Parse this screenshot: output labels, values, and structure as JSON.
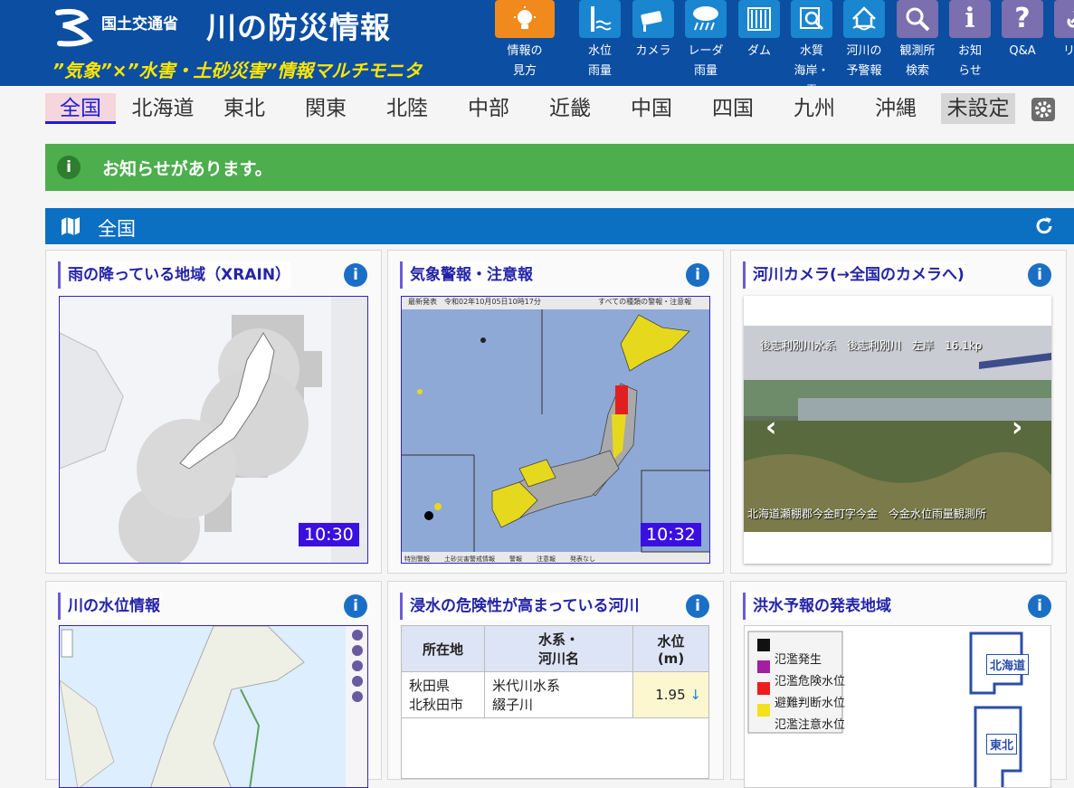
{
  "header": {
    "ministry": "国土交通省",
    "title": "川の防災情報",
    "subtitle": "”気象”×”水害・土砂災害”情報マルチモニタ",
    "icons": [
      {
        "label1": "情報の",
        "label2": "見方",
        "icon": "lightbulb-icon",
        "color": "#f08a1c"
      },
      {
        "label1": "水位",
        "label2": "雨量",
        "icon": "water-level-icon",
        "color": "#1a86d0"
      },
      {
        "label1": "カメラ",
        "label2": "",
        "icon": "camera-icon",
        "color": "#1a86d0"
      },
      {
        "label1": "レーダ",
        "label2": "雨量",
        "icon": "radar-icon",
        "color": "#1a86d0"
      },
      {
        "label1": "ダム",
        "label2": "",
        "icon": "dam-icon",
        "color": "#1a86d0"
      },
      {
        "label1": "水質",
        "label2": "海岸・雪",
        "icon": "water-quality-icon",
        "color": "#1a86d0"
      },
      {
        "label1": "河川の",
        "label2": "予警報",
        "icon": "river-warning-icon",
        "color": "#1a86d0"
      },
      {
        "label1": "観測所",
        "label2": "検索",
        "icon": "search-icon",
        "color": "#7b6fb0"
      },
      {
        "label1": "お知",
        "label2": "らせ",
        "icon": "info-icon",
        "color": "#7b6fb0"
      },
      {
        "label1": "Q&A",
        "label2": "",
        "icon": "question-icon",
        "color": "#7b6fb0"
      },
      {
        "label1": "リン",
        "label2": "",
        "icon": "link-icon",
        "color": "#7b6fb0"
      }
    ]
  },
  "nav": {
    "items": [
      "全国",
      "北海道",
      "東北",
      "関東",
      "北陸",
      "中部",
      "近畿",
      "中国",
      "四国",
      "九州",
      "沖縄",
      "未設定"
    ],
    "active": "全国"
  },
  "notice": {
    "text": "お知らせがあります。"
  },
  "section": {
    "title": "全国"
  },
  "panels": {
    "xrain": {
      "title": "雨の降っている地域（XRAIN）",
      "time": "10:30"
    },
    "warning": {
      "title": "気象警報・注意報",
      "time": "10:32",
      "header_text": "最新発表　令和02年10月05日10時17分",
      "header_right": "すべての種類の警報・注意報",
      "legend": [
        "特別警報",
        "土砂災害警戒情報",
        "警報",
        "注意報",
        "発表なし"
      ]
    },
    "camera": {
      "title": "河川カメラ(→全国のカメラへ)",
      "caption_top": "後志利別川水系　後志利別川　左岸　16.1kp",
      "caption_bottom": "北海道瀬棚郡今金町字今金　今金水位雨量観測所"
    },
    "water_level": {
      "title": "川の水位情報"
    },
    "flood_risk": {
      "title": "浸水の危険性が高まっている河川",
      "headers": {
        "loc": "所在地",
        "river1": "水系・",
        "river2": "河川名",
        "level1": "水位",
        "level2": "(m)"
      },
      "rows": [
        {
          "pref": "秋田県",
          "city": "北秋田市",
          "system": "米代川水系",
          "river": "綴子川",
          "level": "1.95",
          "trend": "↓"
        }
      ]
    },
    "forecast": {
      "title": "洪水予報の発表地域",
      "legend": [
        "氾濫発生",
        "氾濫危険水位",
        "避難判断水位",
        "氾濫注意水位"
      ],
      "regions": [
        "北海道",
        "東北"
      ]
    }
  },
  "colors": {
    "header": "#0b4ea2",
    "notice": "#4cae4c",
    "section": "#0b6fc2",
    "accent": "#2323a8"
  }
}
